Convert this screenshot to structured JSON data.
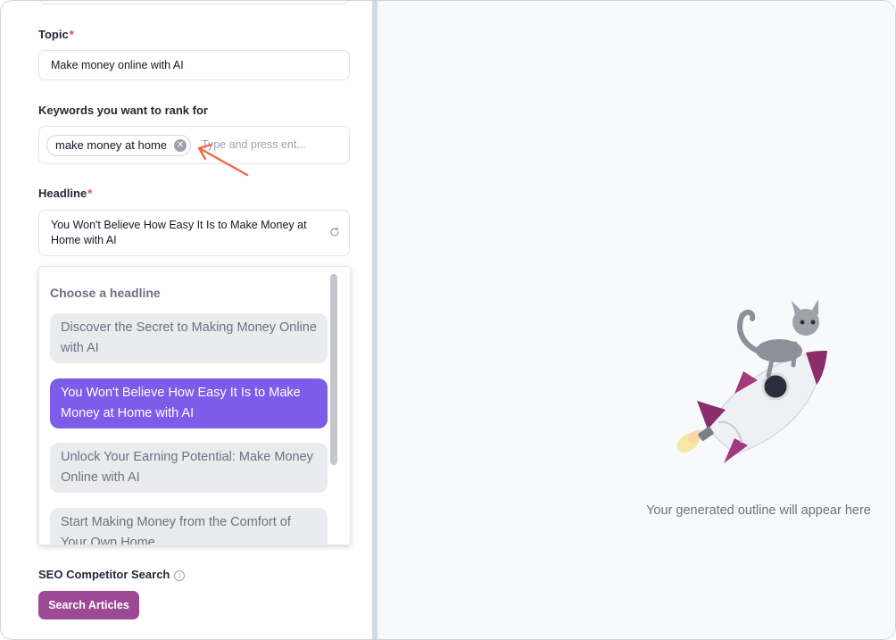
{
  "form": {
    "topic": {
      "label": "Topic",
      "required_mark": "*",
      "value": "Make money online with AI"
    },
    "keywords": {
      "label": "Keywords you want to rank for",
      "chips": [
        "make money at home"
      ],
      "placeholder": "Type and press ent..."
    },
    "headline": {
      "label": "Headline",
      "required_mark": "*",
      "value": "You Won't Believe How Easy It Is to Make Money at Home with AI"
    },
    "headline_dropdown": {
      "title": "Choose a headline",
      "options": [
        "Discover the Secret to Making Money Online with AI",
        "You Won't Believe How Easy It Is to Make Money at Home with AI",
        "Unlock Your Earning Potential: Make Money Online with AI",
        "Start Making Money from the Comfort of Your Own Home"
      ],
      "selected_index": 1
    },
    "seo": {
      "label": "SEO Competitor Search",
      "info_icon": "i",
      "button_label": "Search Articles"
    }
  },
  "preview": {
    "empty_message": "Your generated outline will appear here",
    "illustration": "cat-riding-rocket"
  },
  "colors": {
    "accent_purple": "#7c5ce9",
    "button_plum": "#9c4a96",
    "required_red": "#ef4444",
    "annotation_arrow": "#ef6a4c"
  }
}
